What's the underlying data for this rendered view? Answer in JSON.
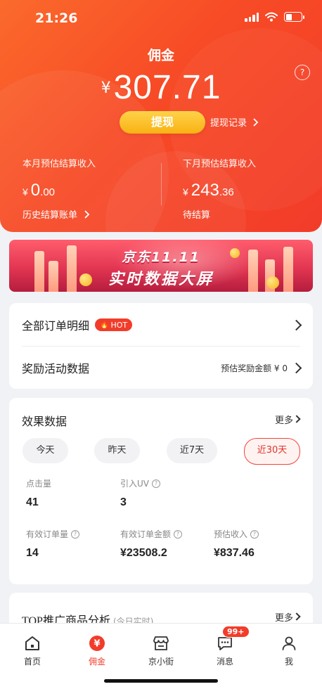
{
  "status_bar": {
    "time": "21:26"
  },
  "header": {
    "title": "佣金",
    "currency": "¥",
    "balance": "307.71",
    "withdraw_label": "提现",
    "withdraw_record_label": "提现记录",
    "this_month": {
      "label": "本月预估结算收入",
      "currency": "¥",
      "int": "0",
      "dec": ".00",
      "link": "历史结算账单"
    },
    "next_month": {
      "label": "下月预估结算收入",
      "currency": "¥",
      "int": "243",
      "dec": ".36",
      "sub": "待结算"
    }
  },
  "banner": {
    "line1": "京东11.11",
    "line2": "实时数据大屏"
  },
  "menu": {
    "orders_label": "全部订单明细",
    "hot_label": "HOT",
    "rewards_label": "奖励活动数据",
    "rewards_value": "预估奖励金额 ¥ 0"
  },
  "effect": {
    "title": "效果数据",
    "more_label": "更多",
    "tabs": [
      "今天",
      "昨天",
      "近7天",
      "近30天"
    ],
    "active_tab": 3,
    "metrics": [
      {
        "label": "点击量",
        "value": "41"
      },
      {
        "label": "引入UV",
        "value": "3"
      },
      {
        "label": "有效订单量",
        "value": "14"
      },
      {
        "label": "有效订单金额",
        "value": "¥23508.2"
      },
      {
        "label": "预估收入",
        "value": "¥837.46"
      }
    ]
  },
  "top": {
    "title": "TOP推广商品分析",
    "subtitle": "(今日实时)",
    "more_label": "更多"
  },
  "tabbar": {
    "items": [
      {
        "label": "首页",
        "icon": "home-icon"
      },
      {
        "label": "佣金",
        "icon": "yen-icon"
      },
      {
        "label": "京小街",
        "icon": "store-icon"
      },
      {
        "label": "消息",
        "icon": "message-icon"
      },
      {
        "label": "我",
        "icon": "person-icon"
      }
    ],
    "message_badge": "99+"
  },
  "colors": {
    "brand": "#f23c2a",
    "button_yellow": "#f9b112"
  }
}
